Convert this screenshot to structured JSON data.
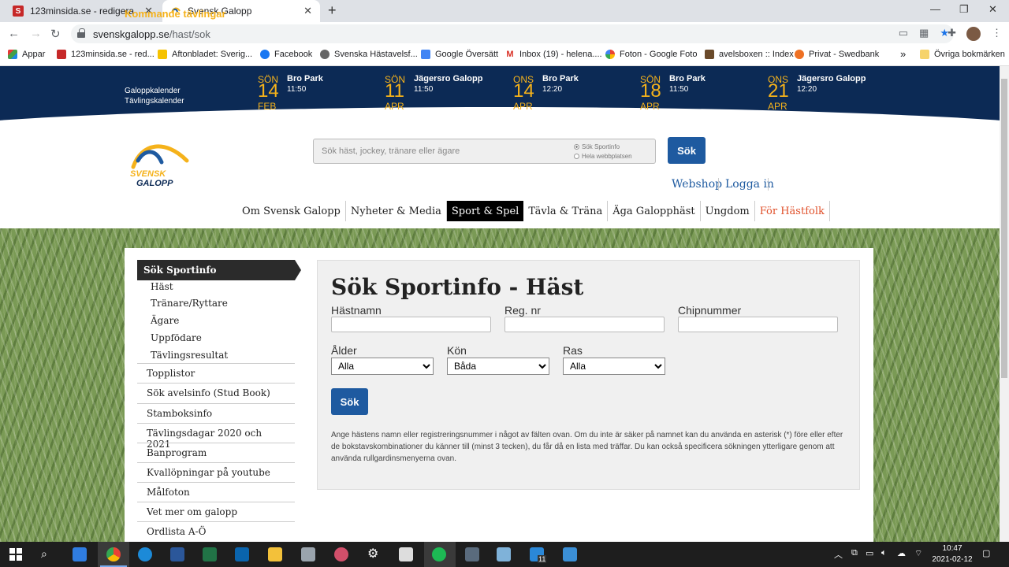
{
  "browser": {
    "tabs": [
      {
        "label": "123minsida.se - redigera",
        "favicon": "123minsida-s-icon"
      },
      {
        "label": "Svensk Galopp",
        "favicon": "svensk-galopp-icon"
      }
    ],
    "url_host": "svenskgalopp.se",
    "url_path": "/hast/sok",
    "bookmarks": [
      "Appar",
      "123minsida.se - red...",
      "Aftonbladet: Sverig...",
      "Facebook",
      "Svenska Hästavelsf...",
      "Google Översätt",
      "Inbox (19) - helena....",
      "Foton - Google Foto",
      "avelsboxen :: Index",
      "Privat - Swedbank"
    ],
    "bookmarks_overflow": "»",
    "other_bookmarks": "Övriga bokmärken"
  },
  "site": {
    "upcoming": {
      "title": "Kommande tävlingar",
      "links": [
        "Galoppkalender",
        "Tävlingskalender"
      ],
      "races": [
        {
          "dow": "SÖN",
          "day": "14",
          "month": "FEB",
          "track": "Bro Park",
          "time": "11:50"
        },
        {
          "dow": "SÖN",
          "day": "11",
          "month": "APR",
          "track": "Jägersro Galopp",
          "time": "11:50"
        },
        {
          "dow": "ONS",
          "day": "14",
          "month": "APR",
          "track": "Bro Park",
          "time": "12:20"
        },
        {
          "dow": "SÖN",
          "day": "18",
          "month": "APR",
          "track": "Bro Park",
          "time": "11:50"
        },
        {
          "dow": "ONS",
          "day": "21",
          "month": "APR",
          "track": "Jägersro Galopp",
          "time": "12:20"
        }
      ]
    },
    "logo": {
      "line1": "SVENSK",
      "line2": "GALOPP"
    },
    "search": {
      "placeholder": "Sök häst, jockey, tränare eller ägare",
      "option_sportinfo": "Sök Sportinfo",
      "option_site": "Hela webbplatsen",
      "button": "Sök"
    },
    "toplinks": {
      "webshop": "Webshop",
      "login": "Logga in"
    },
    "nav": [
      "Om Svensk Galopp",
      "Nyheter & Media",
      "Sport & Spel",
      "Tävla & Träna",
      "Äga Galopphäst",
      "Ungdom",
      "För Hästfolk"
    ],
    "nav_active": "Sport & Spel",
    "sidebar": {
      "head": "Sök Sportinfo",
      "subitems": [
        "Häst",
        "Tränare/Ryttare",
        "Ägare",
        "Uppfödare",
        "Tävlingsresultat"
      ],
      "items": [
        "Topplistor",
        "Sök avelsinfo (Stud Book)",
        "Stamboksinfo",
        "Tävlingsdagar 2020 och 2021",
        "Banprogram",
        "Kvallöpningar på youtube",
        "Målfoton",
        "Vet mer om galopp",
        "Ordlista A-Ö"
      ]
    },
    "form": {
      "title": "Sök Sportinfo - Häst",
      "horse_name_label": "Hästnamn",
      "reg_label": "Reg. nr",
      "chip_label": "Chipnummer",
      "age_label": "Ålder",
      "age_value": "Alla",
      "sex_label": "Kön",
      "sex_value": "Båda",
      "breed_label": "Ras",
      "breed_value": "Alla",
      "button": "Sök",
      "help": "Ange hästens namn eller registreringsnummer i något av fälten ovan. Om du inte är säker på namnet kan du använda en asterisk (*) före eller efter de bokstavskombinationer du känner till (minst 3 tecken), du får då en lista med träffar. Du kan också specificera sökningen ytterligare genom att använda rullgardinsmenyerna ovan."
    }
  },
  "taskbar": {
    "time": "10:47",
    "date": "2021-02-12",
    "badge": "11"
  },
  "colors": {
    "navy": "#0c2a55",
    "gold": "#f5b21b",
    "blue": "#1e5aa0",
    "accent_red": "#e0502a"
  }
}
